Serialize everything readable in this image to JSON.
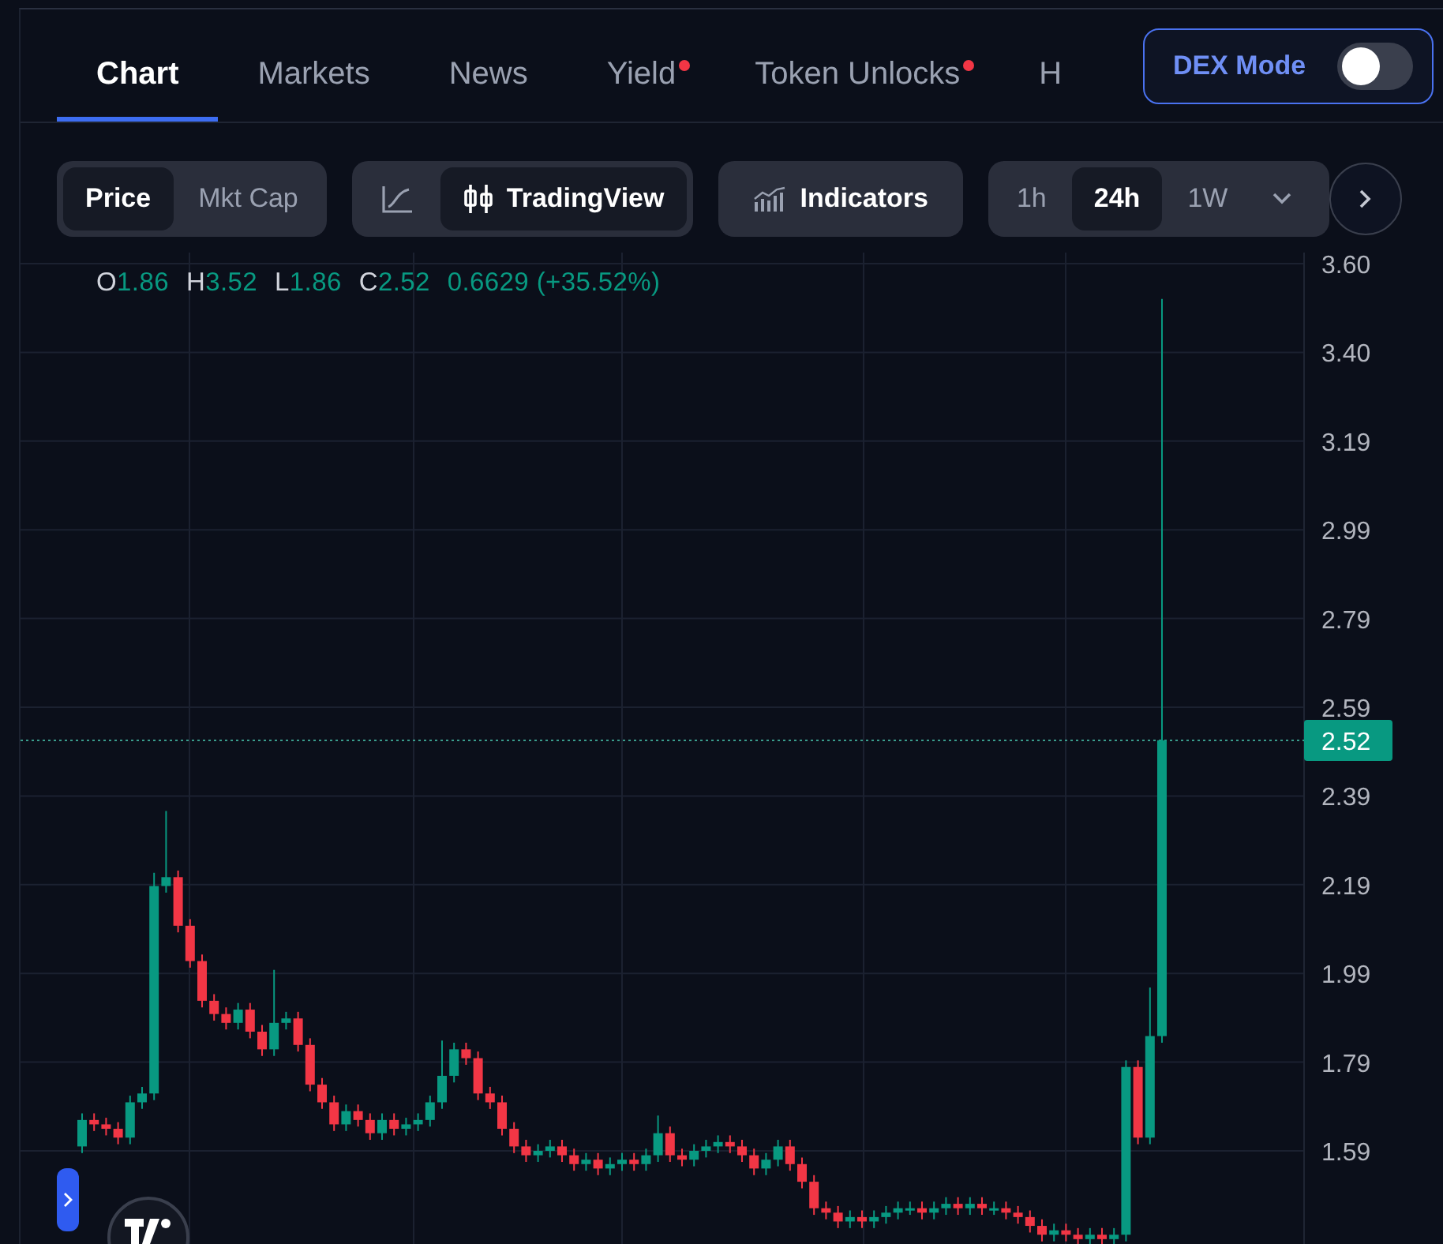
{
  "tabs": [
    {
      "label": "Chart",
      "selected": true,
      "dot": false
    },
    {
      "label": "Markets",
      "selected": false,
      "dot": false
    },
    {
      "label": "News",
      "selected": false,
      "dot": false
    },
    {
      "label": "Yield",
      "selected": false,
      "dot": true
    },
    {
      "label": "Token Unlocks",
      "selected": false,
      "dot": true
    },
    {
      "label": "H",
      "selected": false,
      "dot": false
    }
  ],
  "dex_mode": {
    "label": "DEX Mode",
    "on": false
  },
  "toolbar": {
    "value_type": [
      {
        "label": "Price",
        "selected": true
      },
      {
        "label": "Mkt Cap",
        "selected": false
      }
    ],
    "chart_type": [
      {
        "kind": "line",
        "selected": false
      },
      {
        "kind": "candles",
        "label": "TradingView",
        "selected": true
      }
    ],
    "indicators": "Indicators",
    "intervals": [
      {
        "label": "1h",
        "selected": false
      },
      {
        "label": "24h",
        "selected": true
      },
      {
        "label": "1W",
        "selected": false
      }
    ]
  },
  "legend": {
    "ohlc": [
      {
        "label": "O",
        "value": "1.86"
      },
      {
        "label": "H",
        "value": "3.52"
      },
      {
        "label": "L",
        "value": "1.86"
      },
      {
        "label": "C",
        "value": "2.52"
      }
    ],
    "change": "0.6629 (+35.52%)"
  },
  "price_axis": {
    "labels": [
      "3.60",
      "3.40",
      "3.19",
      "2.99",
      "2.79",
      "2.59",
      "2.39",
      "2.19",
      "1.99",
      "1.79",
      "1.59"
    ],
    "last_price": "2.52"
  }
}
